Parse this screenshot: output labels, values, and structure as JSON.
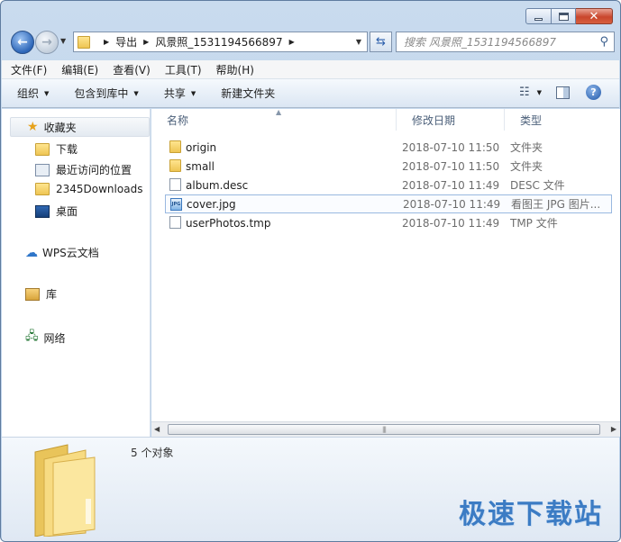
{
  "window": {
    "controls": {
      "minimize": "minimize",
      "maximize": "maximize",
      "close": "close"
    }
  },
  "address": {
    "crumbs": [
      "导出",
      "风景照_1531194566897"
    ]
  },
  "search": {
    "placeholder": "搜索 风景照_1531194566897"
  },
  "menu": [
    "文件(F)",
    "编辑(E)",
    "查看(V)",
    "工具(T)",
    "帮助(H)"
  ],
  "commands": {
    "organize": "组织",
    "include_in_library": "包含到库中",
    "share": "共享",
    "new_folder": "新建文件夹"
  },
  "nav": {
    "favorites": "收藏夹",
    "downloads": "下载",
    "recent": "最近访问的位置",
    "downloads2345": "2345Downloads",
    "desktop": "桌面",
    "wps_cloud": "WPS云文档",
    "libraries": "库",
    "network": "网络"
  },
  "columns": {
    "name": "名称",
    "date": "修改日期",
    "type": "类型"
  },
  "files": [
    {
      "name": "origin",
      "date": "2018-07-10 11:50",
      "type": "文件夹",
      "icon": "folder-icon",
      "selected": false
    },
    {
      "name": "small",
      "date": "2018-07-10 11:50",
      "type": "文件夹",
      "icon": "folder-icon",
      "selected": false
    },
    {
      "name": "album.desc",
      "date": "2018-07-10 11:49",
      "type": "DESC 文件",
      "icon": "file-icon",
      "selected": false
    },
    {
      "name": "cover.jpg",
      "date": "2018-07-10 11:49",
      "type": "看图王 JPG 图片...",
      "icon": "jpg-icon",
      "selected": true
    },
    {
      "name": "userPhotos.tmp",
      "date": "2018-07-10 11:49",
      "type": "TMP 文件",
      "icon": "file-icon",
      "selected": false
    }
  ],
  "details": {
    "count": "5 个对象"
  },
  "watermark": "极速下载站"
}
